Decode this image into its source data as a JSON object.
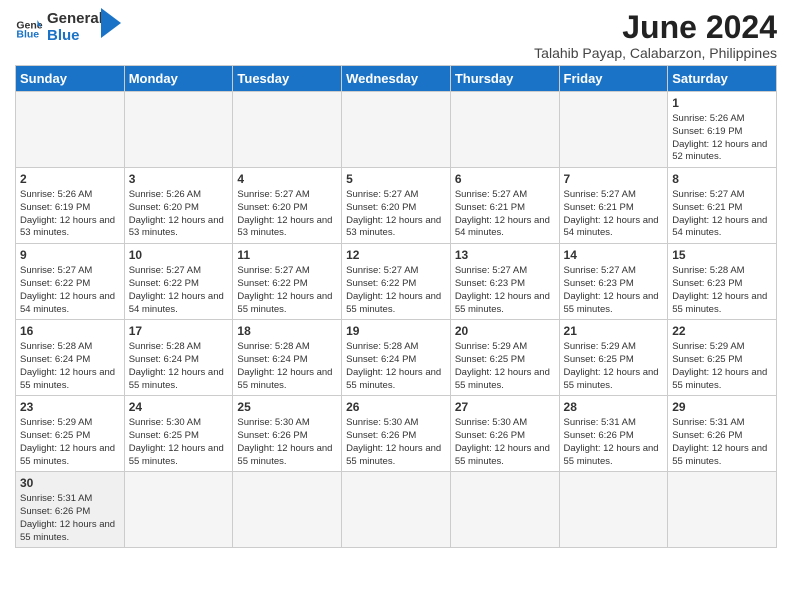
{
  "header": {
    "logo_text_general": "General",
    "logo_text_blue": "Blue",
    "month_title": "June 2024",
    "location": "Talahib Payap, Calabarzon, Philippines"
  },
  "weekdays": [
    "Sunday",
    "Monday",
    "Tuesday",
    "Wednesday",
    "Thursday",
    "Friday",
    "Saturday"
  ],
  "weeks": [
    [
      {
        "day": "",
        "info": ""
      },
      {
        "day": "",
        "info": ""
      },
      {
        "day": "",
        "info": ""
      },
      {
        "day": "",
        "info": ""
      },
      {
        "day": "",
        "info": ""
      },
      {
        "day": "",
        "info": ""
      },
      {
        "day": "1",
        "info": "Sunrise: 5:26 AM\nSunset: 6:19 PM\nDaylight: 12 hours and 52 minutes."
      }
    ],
    [
      {
        "day": "2",
        "info": "Sunrise: 5:26 AM\nSunset: 6:19 PM\nDaylight: 12 hours and 53 minutes."
      },
      {
        "day": "3",
        "info": "Sunrise: 5:26 AM\nSunset: 6:20 PM\nDaylight: 12 hours and 53 minutes."
      },
      {
        "day": "4",
        "info": "Sunrise: 5:27 AM\nSunset: 6:20 PM\nDaylight: 12 hours and 53 minutes."
      },
      {
        "day": "5",
        "info": "Sunrise: 5:27 AM\nSunset: 6:20 PM\nDaylight: 12 hours and 53 minutes."
      },
      {
        "day": "6",
        "info": "Sunrise: 5:27 AM\nSunset: 6:21 PM\nDaylight: 12 hours and 54 minutes."
      },
      {
        "day": "7",
        "info": "Sunrise: 5:27 AM\nSunset: 6:21 PM\nDaylight: 12 hours and 54 minutes."
      },
      {
        "day": "8",
        "info": "Sunrise: 5:27 AM\nSunset: 6:21 PM\nDaylight: 12 hours and 54 minutes."
      }
    ],
    [
      {
        "day": "9",
        "info": "Sunrise: 5:27 AM\nSunset: 6:22 PM\nDaylight: 12 hours and 54 minutes."
      },
      {
        "day": "10",
        "info": "Sunrise: 5:27 AM\nSunset: 6:22 PM\nDaylight: 12 hours and 54 minutes."
      },
      {
        "day": "11",
        "info": "Sunrise: 5:27 AM\nSunset: 6:22 PM\nDaylight: 12 hours and 55 minutes."
      },
      {
        "day": "12",
        "info": "Sunrise: 5:27 AM\nSunset: 6:22 PM\nDaylight: 12 hours and 55 minutes."
      },
      {
        "day": "13",
        "info": "Sunrise: 5:27 AM\nSunset: 6:23 PM\nDaylight: 12 hours and 55 minutes."
      },
      {
        "day": "14",
        "info": "Sunrise: 5:27 AM\nSunset: 6:23 PM\nDaylight: 12 hours and 55 minutes."
      },
      {
        "day": "15",
        "info": "Sunrise: 5:28 AM\nSunset: 6:23 PM\nDaylight: 12 hours and 55 minutes."
      }
    ],
    [
      {
        "day": "16",
        "info": "Sunrise: 5:28 AM\nSunset: 6:24 PM\nDaylight: 12 hours and 55 minutes."
      },
      {
        "day": "17",
        "info": "Sunrise: 5:28 AM\nSunset: 6:24 PM\nDaylight: 12 hours and 55 minutes."
      },
      {
        "day": "18",
        "info": "Sunrise: 5:28 AM\nSunset: 6:24 PM\nDaylight: 12 hours and 55 minutes."
      },
      {
        "day": "19",
        "info": "Sunrise: 5:28 AM\nSunset: 6:24 PM\nDaylight: 12 hours and 55 minutes."
      },
      {
        "day": "20",
        "info": "Sunrise: 5:29 AM\nSunset: 6:25 PM\nDaylight: 12 hours and 55 minutes."
      },
      {
        "day": "21",
        "info": "Sunrise: 5:29 AM\nSunset: 6:25 PM\nDaylight: 12 hours and 55 minutes."
      },
      {
        "day": "22",
        "info": "Sunrise: 5:29 AM\nSunset: 6:25 PM\nDaylight: 12 hours and 55 minutes."
      }
    ],
    [
      {
        "day": "23",
        "info": "Sunrise: 5:29 AM\nSunset: 6:25 PM\nDaylight: 12 hours and 55 minutes."
      },
      {
        "day": "24",
        "info": "Sunrise: 5:30 AM\nSunset: 6:25 PM\nDaylight: 12 hours and 55 minutes."
      },
      {
        "day": "25",
        "info": "Sunrise: 5:30 AM\nSunset: 6:26 PM\nDaylight: 12 hours and 55 minutes."
      },
      {
        "day": "26",
        "info": "Sunrise: 5:30 AM\nSunset: 6:26 PM\nDaylight: 12 hours and 55 minutes."
      },
      {
        "day": "27",
        "info": "Sunrise: 5:30 AM\nSunset: 6:26 PM\nDaylight: 12 hours and 55 minutes."
      },
      {
        "day": "28",
        "info": "Sunrise: 5:31 AM\nSunset: 6:26 PM\nDaylight: 12 hours and 55 minutes."
      },
      {
        "day": "29",
        "info": "Sunrise: 5:31 AM\nSunset: 6:26 PM\nDaylight: 12 hours and 55 minutes."
      }
    ],
    [
      {
        "day": "30",
        "info": "Sunrise: 5:31 AM\nSunset: 6:26 PM\nDaylight: 12 hours and 55 minutes."
      },
      {
        "day": "",
        "info": ""
      },
      {
        "day": "",
        "info": ""
      },
      {
        "day": "",
        "info": ""
      },
      {
        "day": "",
        "info": ""
      },
      {
        "day": "",
        "info": ""
      },
      {
        "day": "",
        "info": ""
      }
    ]
  ]
}
